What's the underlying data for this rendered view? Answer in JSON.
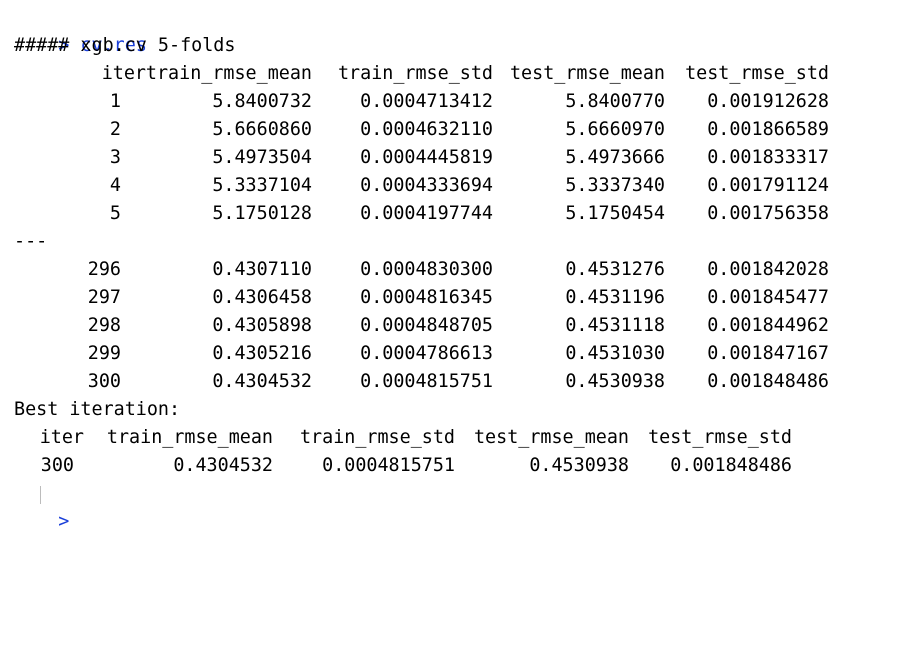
{
  "prev_output": "— —",
  "prompt_symbol": ">",
  "command": "cv.res",
  "header": "##### xgb.cv 5-folds",
  "columns": [
    "iter",
    "train_rmse_mean",
    "train_rmse_std",
    "test_rmse_mean",
    "test_rmse_std"
  ],
  "rows_head": [
    [
      "1",
      "5.8400732",
      "0.0004713412",
      "5.8400770",
      "0.001912628"
    ],
    [
      "2",
      "5.6660860",
      "0.0004632110",
      "5.6660970",
      "0.001866589"
    ],
    [
      "3",
      "5.4973504",
      "0.0004445819",
      "5.4973666",
      "0.001833317"
    ],
    [
      "4",
      "5.3337104",
      "0.0004333694",
      "5.3337340",
      "0.001791124"
    ],
    [
      "5",
      "5.1750128",
      "0.0004197744",
      "5.1750454",
      "0.001756358"
    ]
  ],
  "separator": "---",
  "rows_tail": [
    [
      "296",
      "0.4307110",
      "0.0004830300",
      "0.4531276",
      "0.001842028"
    ],
    [
      "297",
      "0.4306458",
      "0.0004816345",
      "0.4531196",
      "0.001845477"
    ],
    [
      "298",
      "0.4305898",
      "0.0004848705",
      "0.4531118",
      "0.001844962"
    ],
    [
      "299",
      "0.4305216",
      "0.0004786613",
      "0.4531030",
      "0.001847167"
    ],
    [
      "300",
      "0.4304532",
      "0.0004815751",
      "0.4530938",
      "0.001848486"
    ]
  ],
  "best_label": "Best iteration:",
  "best_columns": [
    "iter",
    "train_rmse_mean",
    "train_rmse_std",
    "test_rmse_mean",
    "test_rmse_std"
  ],
  "best_row": [
    "300",
    "0.4304532",
    "0.0004815751",
    "0.4530938",
    "0.001848486"
  ],
  "final_prompt": ">"
}
